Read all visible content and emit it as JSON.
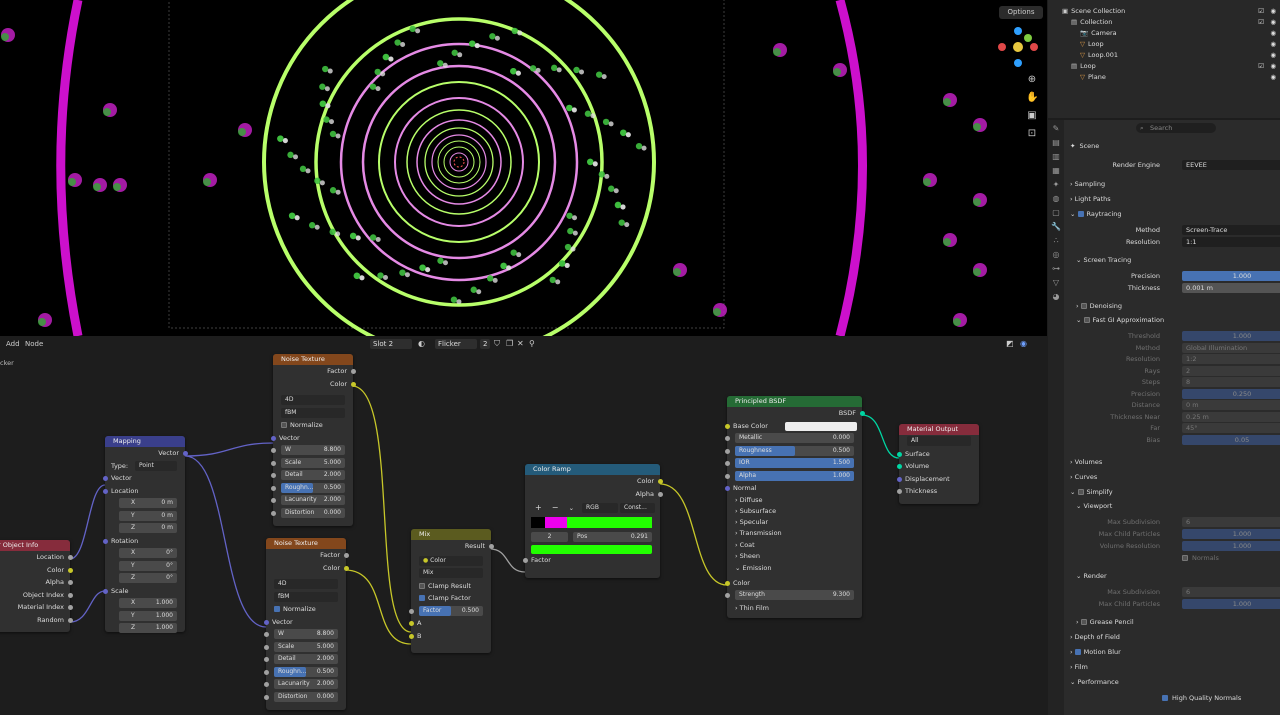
{
  "viewport": {
    "options_label": "Options"
  },
  "node_editor": {
    "header": {
      "menu_add": "Add",
      "menu_node": "Node",
      "slot": "Slot 2",
      "material": "Flicker",
      "users": "2",
      "left_cut": "cker"
    },
    "object_info": {
      "title": "r Object Info",
      "outputs": [
        "Location",
        "Color",
        "Alpha",
        "Object Index",
        "Material Index",
        "Random"
      ]
    },
    "mapping": {
      "title": "Mapping",
      "output": "Vector",
      "type_label": "Type:",
      "type_value": "Point",
      "vector": "Vector",
      "location": "Location",
      "loc": [
        [
          "X",
          "0 m"
        ],
        [
          "Y",
          "0 m"
        ],
        [
          "Z",
          "0 m"
        ]
      ],
      "rotation": "Rotation",
      "rot": [
        [
          "X",
          "0°"
        ],
        [
          "Y",
          "0°"
        ],
        [
          "Z",
          "0°"
        ]
      ],
      "scale": "Scale",
      "scl": [
        [
          "X",
          "1.000"
        ],
        [
          "Y",
          "1.000"
        ],
        [
          "Z",
          "1.000"
        ]
      ]
    },
    "noise1": {
      "title": "Noise Texture",
      "out_factor": "Factor",
      "out_color": "Color",
      "dim": "4D",
      "type": "fBM",
      "normalize": "Normalize",
      "vector": "Vector",
      "fields": [
        [
          "W",
          "8.800"
        ],
        [
          "Scale",
          "5.000"
        ],
        [
          "Detail",
          "2.000"
        ],
        [
          "Roughn...",
          "0.500"
        ],
        [
          "Lacunarity",
          "2.000"
        ],
        [
          "Distortion",
          "0.000"
        ]
      ]
    },
    "noise2": {
      "title": "Noise Texture",
      "out_factor": "Factor",
      "out_color": "Color",
      "dim": "4D",
      "type": "fBM",
      "normalize": "Normalize",
      "vector": "Vector",
      "fields": [
        [
          "W",
          "8.800"
        ],
        [
          "Scale",
          "5.000"
        ],
        [
          "Detail",
          "2.000"
        ],
        [
          "Roughn...",
          "0.500"
        ],
        [
          "Lacunarity",
          "2.000"
        ],
        [
          "Distortion",
          "0.000"
        ]
      ]
    },
    "mix": {
      "title": "Mix",
      "result": "Result",
      "data_type": "Color",
      "blend": "Mix",
      "clamp_result": "Clamp Result",
      "clamp_factor": "Clamp Factor",
      "factor_label": "Factor",
      "factor_value": "0.500",
      "a": "A",
      "b": "B"
    },
    "color_ramp": {
      "title": "Color Ramp",
      "out_color": "Color",
      "out_alpha": "Alpha",
      "plus": "+",
      "minus": "−",
      "mode": "RGB",
      "interp": "Const...",
      "index": "2",
      "pos_label": "Pos",
      "pos_value": "0.291",
      "factor": "Factor"
    },
    "bsdf": {
      "title": "Principled BSDF",
      "out": "BSDF",
      "base_color": "Base Color",
      "fields": [
        [
          "Metallic",
          "0.000"
        ],
        [
          "Roughness",
          "0.500"
        ],
        [
          "IOR",
          "1.500"
        ],
        [
          "Alpha",
          "1.000"
        ]
      ],
      "normal": "Normal",
      "subpanels": [
        "Diffuse",
        "Subsurface",
        "Specular",
        "Transmission",
        "Coat",
        "Sheen"
      ],
      "emission": "Emission",
      "em_color": "Color",
      "strength_label": "Strength",
      "strength_value": "9.300",
      "thin_film": "Thin Film"
    },
    "output": {
      "title": "Material Output",
      "target": "All",
      "inputs": [
        "Surface",
        "Volume",
        "Displacement",
        "Thickness"
      ]
    }
  },
  "outliner": {
    "items": [
      [
        "Scene Collection",
        0
      ],
      [
        "Collection",
        1
      ],
      [
        "Camera",
        2
      ],
      [
        "Loop",
        2
      ],
      [
        "Loop.001",
        2
      ],
      [
        "Loop",
        1
      ],
      [
        "Plane",
        2
      ]
    ]
  },
  "properties": {
    "search_placeholder": "Search",
    "scene": "Scene",
    "render_engine_label": "Render Engine",
    "render_engine": "EEVEE",
    "sampling": "Sampling",
    "light_paths": "Light Paths",
    "raytracing": "Raytracing",
    "method_label": "Method",
    "method": "Screen-Trace",
    "resolution_label": "Resolution",
    "resolution": "1:1",
    "screen_tracing": "Screen Tracing",
    "precision_label": "Precision",
    "precision": "1.000",
    "thickness_label": "Thickness",
    "thickness": "0.001 m",
    "denoising": "Denoising",
    "fast_gi": "Fast GI Approximation",
    "gi": [
      [
        "Threshold",
        "1.000"
      ],
      [
        "Method",
        "Global Illumination"
      ],
      [
        "Resolution",
        "1:2"
      ],
      [
        "Rays",
        "2"
      ],
      [
        "Steps",
        "8"
      ],
      [
        "Precision",
        "0.250"
      ],
      [
        "Distance",
        "0 m"
      ],
      [
        "Thickness Near",
        "0.25 m"
      ],
      [
        "Far",
        "45°"
      ],
      [
        "Bias",
        "0.05"
      ]
    ],
    "volumes": "Volumes",
    "curves": "Curves",
    "simplify": "Simplify",
    "viewport": "Viewport",
    "vp": [
      [
        "Max Subdivision",
        "6"
      ],
      [
        "Max Child Particles",
        "1.000"
      ],
      [
        "Volume Resolution",
        "1.000"
      ]
    ],
    "normals": "Normals",
    "render": "Render",
    "rn": [
      [
        "Max Subdivision",
        "6"
      ],
      [
        "Max Child Particles",
        "1.000"
      ]
    ],
    "grease_pencil": "Grease Pencil",
    "dof": "Depth of Field",
    "motion_blur": "Motion Blur",
    "film": "Film",
    "performance": "Performance",
    "hq_normals": "High Quality Normals"
  }
}
